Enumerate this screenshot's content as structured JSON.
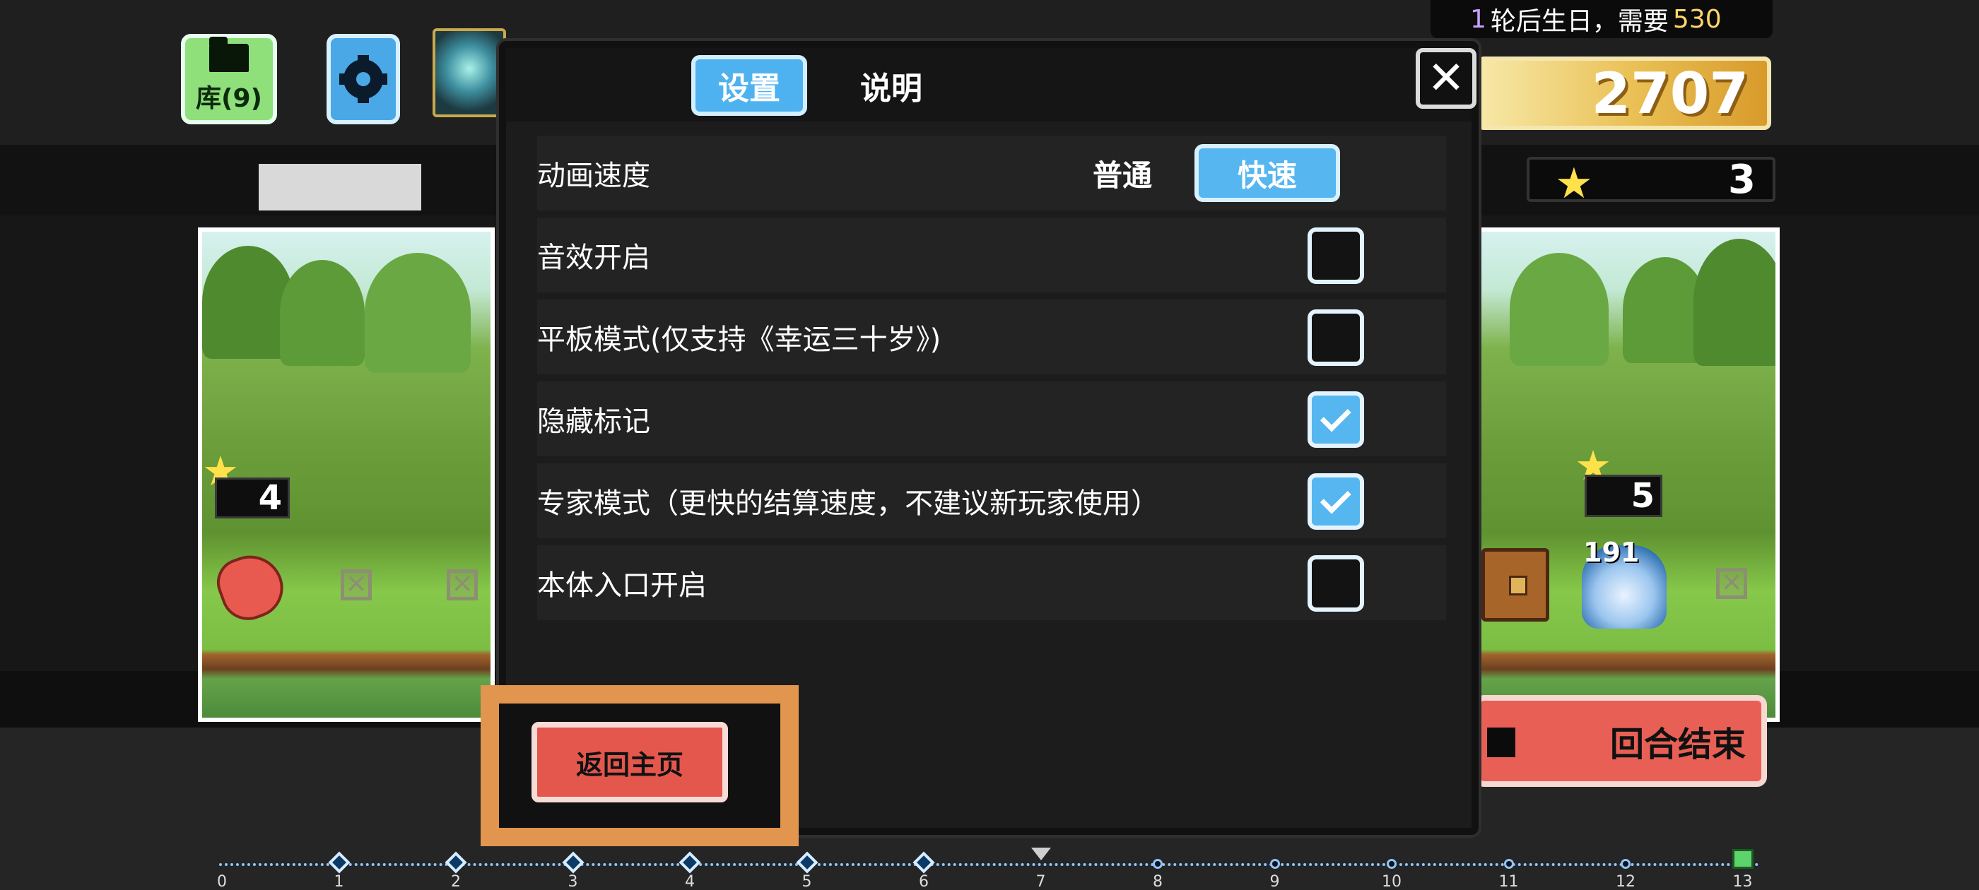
{
  "top_left": {
    "library_label": "库(9)",
    "icons": [
      "folder-icon",
      "gear-icon"
    ]
  },
  "top_right": {
    "birthday_num": "1",
    "birthday_text": "轮后生日，需要",
    "birthday_cost": "530",
    "gold": "2707",
    "stars": "3"
  },
  "scenes": {
    "left_hp": "4",
    "right_hp": "5",
    "right_enemy_level": "191"
  },
  "end_turn_label": "回合结束",
  "timeline": {
    "ticks": [
      "0",
      "1",
      "2",
      "3",
      "4",
      "5",
      "6",
      "7",
      "8",
      "9",
      "10",
      "11",
      "12",
      "13"
    ]
  },
  "modal": {
    "tabs": [
      "设置",
      "说明"
    ],
    "close_symbol": "✕",
    "rows": [
      {
        "label": "动画速度",
        "type": "speed",
        "options": [
          "普通",
          "快速"
        ],
        "selected": "快速"
      },
      {
        "label": "音效开启",
        "type": "checkbox",
        "checked": false
      },
      {
        "label": "平板模式(仅支持《幸运三十岁》)",
        "type": "checkbox",
        "checked": false
      },
      {
        "label": "隐藏标记",
        "type": "checkbox",
        "checked": true
      },
      {
        "label": "专家模式（更快的结算速度，不建议新玩家使用）",
        "type": "checkbox",
        "checked": true
      },
      {
        "label": "本体入口开启",
        "type": "checkbox",
        "checked": false
      }
    ],
    "home_label": "返回主页"
  },
  "colors": {
    "accent_blue": "#56b6f0",
    "accent_red": "#e4574d",
    "highlight": "#e2954f",
    "gold": "#e9bf53"
  }
}
